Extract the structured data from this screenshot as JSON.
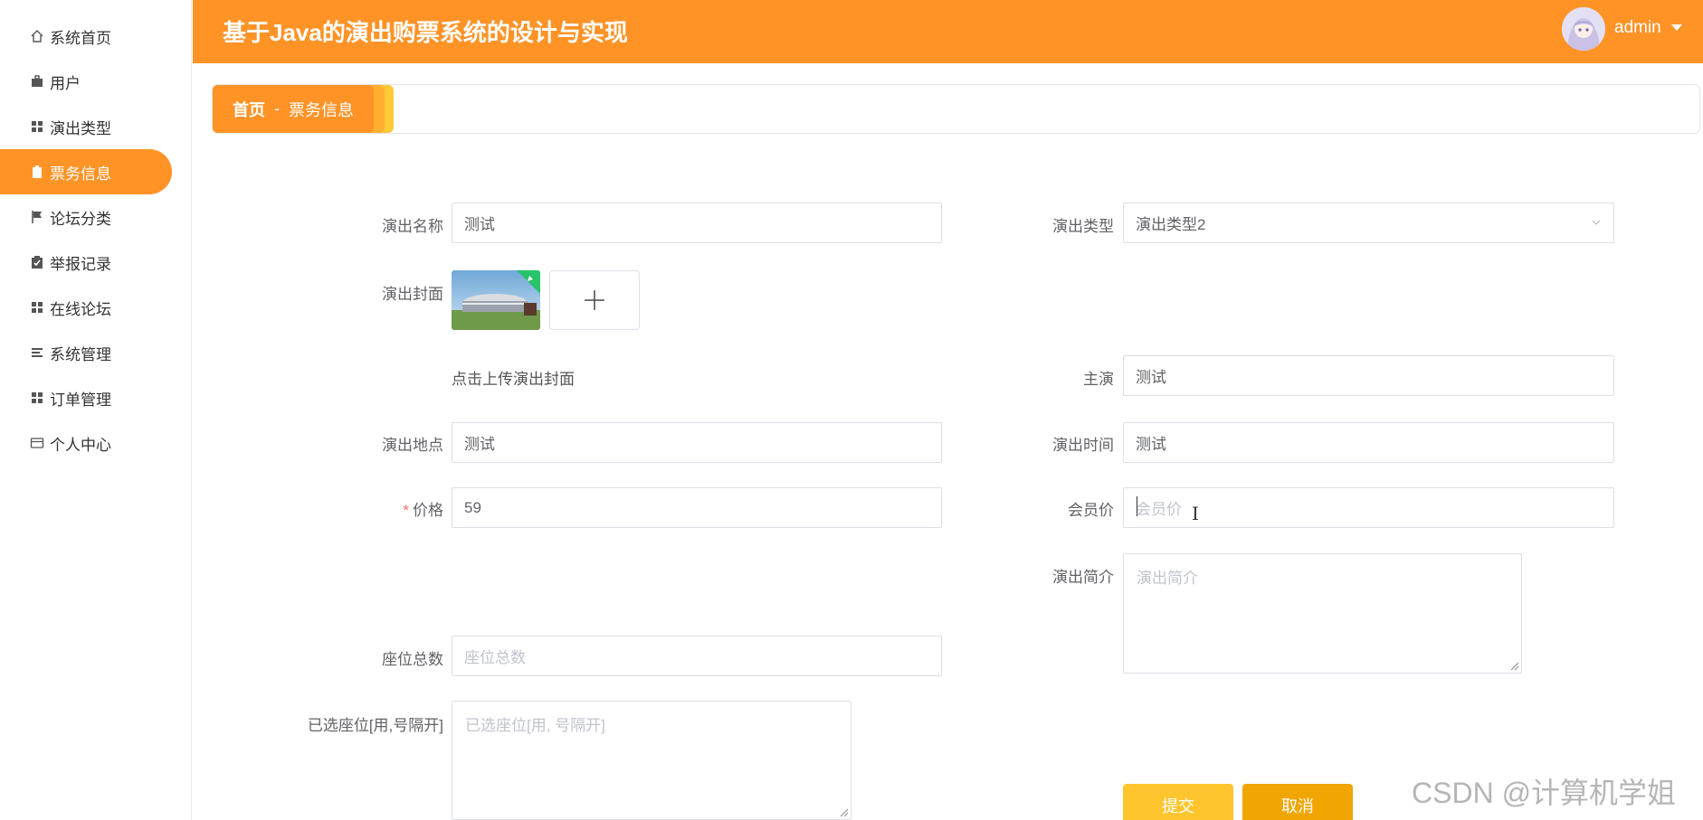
{
  "app": {
    "title": "基于Java的演出购票系统的设计与实现",
    "user": "admin"
  },
  "sidebar": {
    "items": [
      {
        "label": "系统首页",
        "icon": "home-icon"
      },
      {
        "label": "用户",
        "icon": "briefcase-icon"
      },
      {
        "label": "演出类型",
        "icon": "grid-icon"
      },
      {
        "label": "票务信息",
        "icon": "clipboard-icon",
        "active": true
      },
      {
        "label": "论坛分类",
        "icon": "flag-icon"
      },
      {
        "label": "举报记录",
        "icon": "clipboard-check-icon"
      },
      {
        "label": "在线论坛",
        "icon": "grid-icon"
      },
      {
        "label": "系统管理",
        "icon": "list-icon"
      },
      {
        "label": "订单管理",
        "icon": "grid-icon"
      },
      {
        "label": "个人中心",
        "icon": "card-icon"
      }
    ]
  },
  "breadcrumb": {
    "home": "首页",
    "separator": "-",
    "current": "票务信息"
  },
  "form": {
    "name": {
      "label": "演出名称",
      "value": "测试"
    },
    "type": {
      "label": "演出类型",
      "value": "演出类型2"
    },
    "cover": {
      "label": "演出封面",
      "hint": "点击上传演出封面"
    },
    "star": {
      "label": "主演",
      "value": "测试"
    },
    "venue": {
      "label": "演出地点",
      "value": "测试"
    },
    "time": {
      "label": "演出时间",
      "value": "测试"
    },
    "price": {
      "label": "价格",
      "required_mark": "*",
      "value": "59"
    },
    "member_price": {
      "label": "会员价",
      "placeholder": "会员价"
    },
    "intro": {
      "label": "演出简介",
      "placeholder": "演出简介"
    },
    "seats_total": {
      "label": "座位总数",
      "placeholder": "座位总数"
    },
    "seats_selected": {
      "label": "已选座位[用,号隔开]",
      "placeholder": "已选座位[用, 号隔开]"
    }
  },
  "buttons": {
    "submit": "提交",
    "cancel": "取消"
  },
  "watermark": "CSDN @计算机学姐",
  "colors": {
    "accent": "#ff9326",
    "submit": "#ffc52e",
    "cancel": "#f0a500"
  }
}
